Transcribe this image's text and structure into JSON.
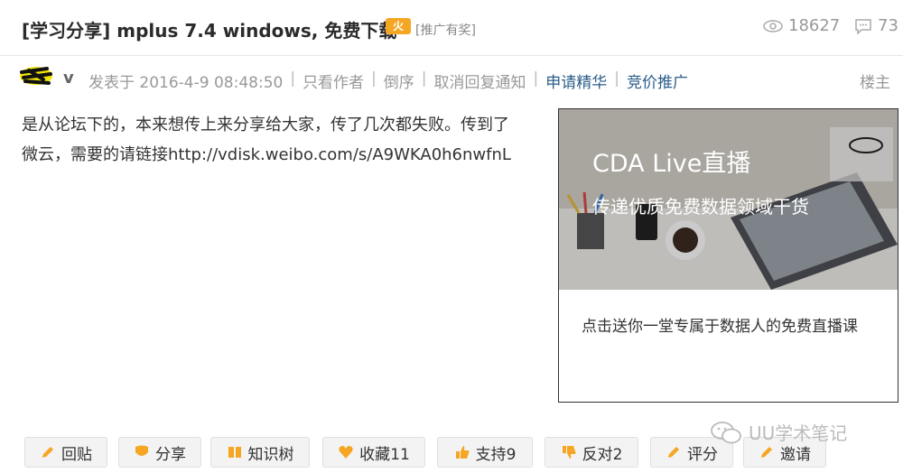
{
  "header": {
    "title": "[学习分享] mplus 7.4 windows, 免费下载",
    "hot_badge": "火",
    "promo_tag": "[推广有奖]",
    "views": "18627",
    "replies": "73"
  },
  "meta": {
    "vip_mark": "v",
    "posted": "发表于 2016-4-9 08:48:50",
    "only_author": "只看作者",
    "reverse": "倒序",
    "cancel_notify": "取消回复通知",
    "apply_featured": "申请精华",
    "promote": "竞价推广",
    "floor": "楼主",
    "sep": "|"
  },
  "post": {
    "line1": "是从论坛下的，本来想传上来分享给大家，传了几次都失败。传到了",
    "line2": "微云，需要的请链接http://vdisk.weibo.com/s/A9WKA0h6nwfnL"
  },
  "ad": {
    "headline": "CDA Live直播",
    "subline": "传递优质免费数据领域干货",
    "caption": "点击送你一堂专属于数据人的免费直播课"
  },
  "actions": [
    {
      "label": "回贴"
    },
    {
      "label": "分享"
    },
    {
      "label": "知识树"
    },
    {
      "label": "收藏11"
    },
    {
      "label": "支持9"
    },
    {
      "label": "反对2"
    },
    {
      "label": "评分"
    },
    {
      "label": "邀请"
    }
  ],
  "watermark": "UU学术笔记",
  "colors": {
    "accent_orange": "#f5a623",
    "link_blue": "#2b5d8a",
    "muted_gray": "#999999"
  }
}
